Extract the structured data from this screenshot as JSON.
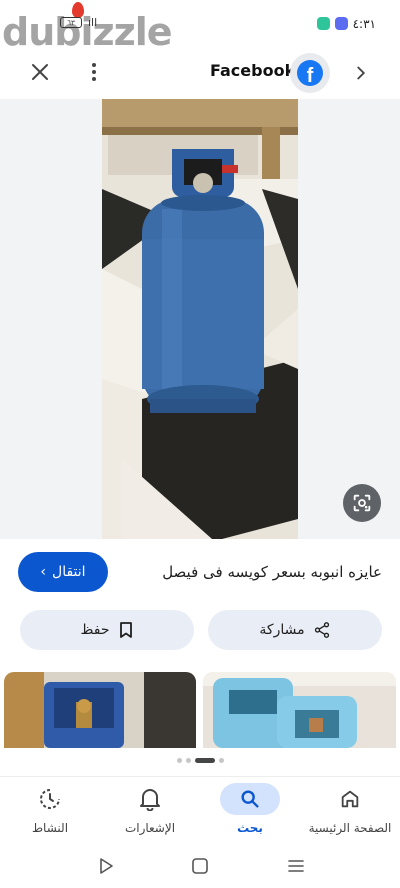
{
  "status_bar": {
    "time": "٤:٣١",
    "battery": "٦٣",
    "signal": "ıll",
    "watermark": "dubizzle"
  },
  "topbar": {
    "source": "Facebook",
    "facebook_logo": "f"
  },
  "result": {
    "title": "عايزه انبوبه بسعر كويسه فى فيصل",
    "visit_label": "انتقال",
    "save_label": "حفظ",
    "share_label": "مشاركة"
  },
  "bottom_nav": {
    "items": [
      {
        "label": "النشاط",
        "icon": "activity-icon"
      },
      {
        "label": "الإشعارات",
        "icon": "bell-icon"
      },
      {
        "label": "بحث",
        "icon": "search-icon",
        "active": true
      },
      {
        "label": "الصفحة الرئيسية",
        "icon": "home-icon"
      }
    ]
  },
  "colors": {
    "accent": "#0b57d0",
    "chip_bg": "#e9eef6",
    "facebook": "#1877f2"
  }
}
